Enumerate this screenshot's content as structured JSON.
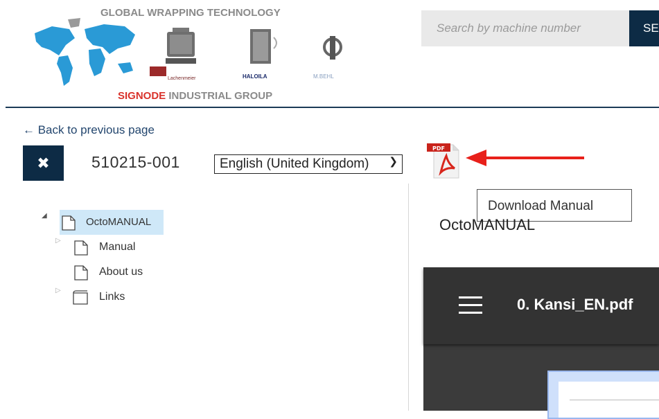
{
  "header": {
    "logo_title": "GLOBAL WRAPPING TECHNOLOGY",
    "logo_group_brand": "SIGNODE",
    "logo_group_rest": " INDUSTRIAL GROUP",
    "brands": [
      "Lachenmeier",
      "HALOILA",
      "M.BEHL"
    ],
    "search_placeholder": "Search by machine number",
    "search_button": "SE"
  },
  "nav": {
    "back_link": "← Back to previous page"
  },
  "toolbar": {
    "close_symbol": "✖",
    "machine_number": "510215-001",
    "language_selected": "English (United Kingdom)",
    "pdf_badge": "PDF",
    "tooltip": "Download Manual"
  },
  "tree": {
    "root": {
      "label": "OctoMANUAL",
      "expanded": true
    },
    "children": [
      {
        "label": "Manual",
        "has_children": true,
        "icon": "page-icon"
      },
      {
        "label": "About us",
        "has_children": false,
        "icon": "page-icon"
      },
      {
        "label": "Links",
        "has_children": true,
        "icon": "folder-icon"
      }
    ]
  },
  "content": {
    "title": "OctoMANUAL",
    "viewer_filename": "0. Kansi_EN.pdf"
  },
  "colors": {
    "navy": "#0d2b45",
    "accent_red": "#e8201a",
    "tree_highlight": "#cfe8f8",
    "viewer_dark": "#333333"
  }
}
